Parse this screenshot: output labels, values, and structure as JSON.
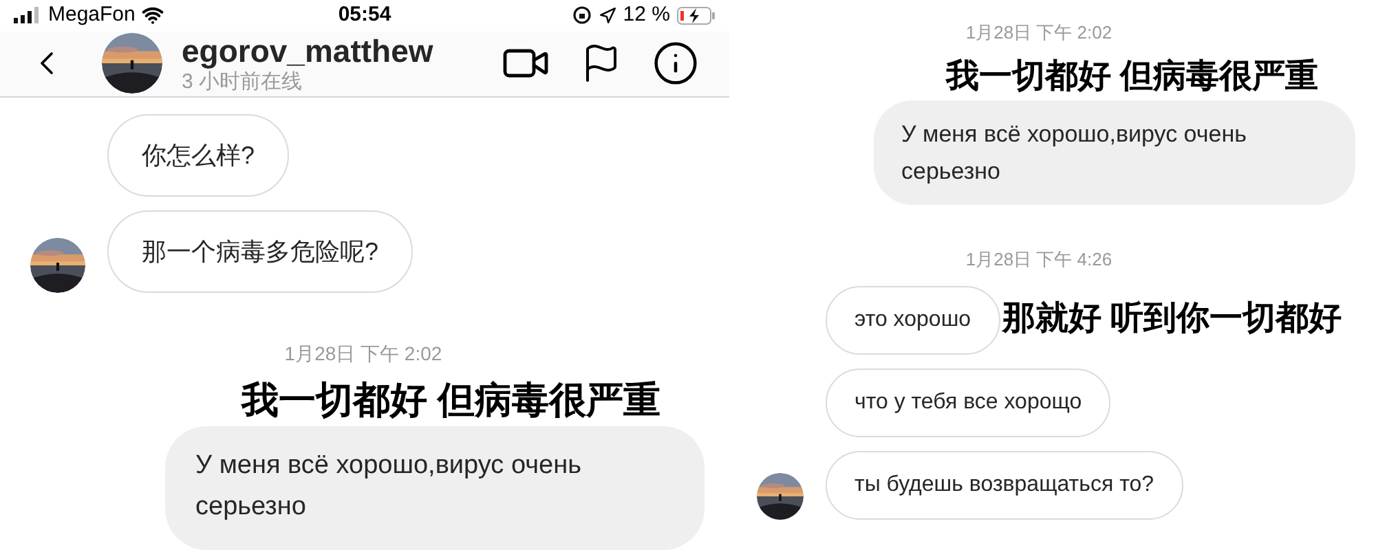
{
  "panels": [
    {
      "status_bar": {
        "carrier": "MegaFon",
        "time": "05:54",
        "battery": "12 %"
      },
      "header": {
        "username": "egorov_matthew",
        "last_seen": "3 小时前在线"
      },
      "messages": [
        {
          "kind": "received",
          "text": "你怎么样?",
          "avatar": false
        },
        {
          "kind": "received",
          "text": "那一个病毒多危险呢?",
          "avatar": true
        },
        {
          "kind": "timestamp",
          "text": "1月28日 下午 2:02"
        },
        {
          "kind": "sent",
          "text": "У меня всё хорошо,вирус очень серьезно",
          "caption": "我一切都好 但病毒很严重"
        }
      ]
    },
    {
      "messages": [
        {
          "kind": "timestamp",
          "text": "1月28日 下午 2:02"
        },
        {
          "kind": "sent",
          "text": "У меня всё хорошо,вирус очень серьезно",
          "caption": "我一切都好 但病毒很严重"
        },
        {
          "kind": "timestamp",
          "text": "1月28日 下午 4:26"
        },
        {
          "kind": "received",
          "text": "это хорошо",
          "avatar": false,
          "caption": "那就好 听到你一切都好"
        },
        {
          "kind": "received",
          "text": "что у тебя все хорощо",
          "avatar": false
        },
        {
          "kind": "received",
          "text": "ты будешь возвращаться то?",
          "avatar": true
        }
      ]
    }
  ]
}
